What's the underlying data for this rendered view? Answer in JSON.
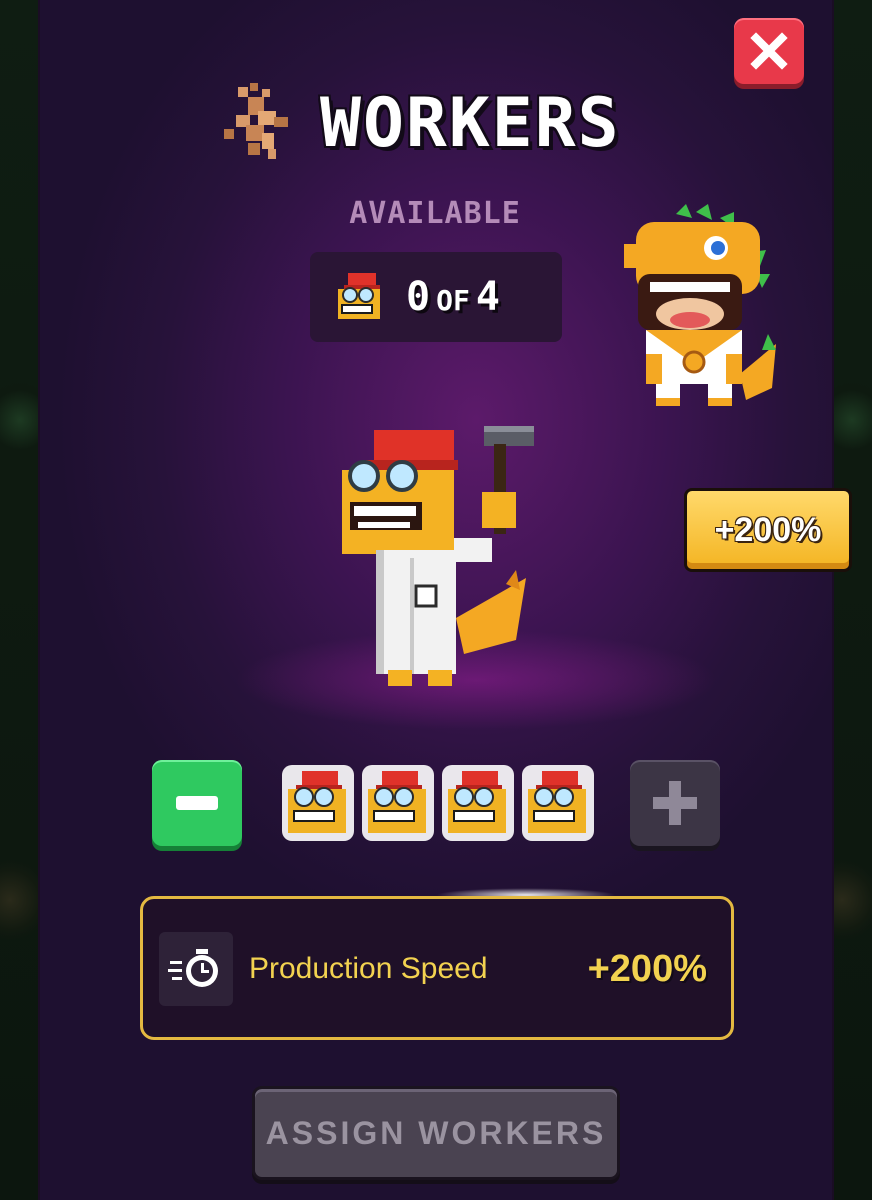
{
  "screen": {
    "title": "WORKERS",
    "close_icon": "close-x-icon"
  },
  "available": {
    "label": "AVAILABLE",
    "current": "0",
    "of_label": "OF",
    "total": "4"
  },
  "bonus_badge": {
    "text": "+200%"
  },
  "stepper": {
    "minus_icon": "minus-icon",
    "plus_icon": "plus-icon",
    "slots": [
      {
        "icon": "worker-head-icon",
        "filled": true
      },
      {
        "icon": "worker-head-icon",
        "filled": true
      },
      {
        "icon": "worker-head-icon",
        "filled": true
      },
      {
        "icon": "worker-head-icon",
        "filled": true
      }
    ]
  },
  "stat": {
    "icon": "fast-clock-icon",
    "label": "Production Speed",
    "value": "+200%"
  },
  "actions": {
    "assign_label": "ASSIGN WORKERS"
  },
  "colors": {
    "accent_gold": "#f2d250",
    "close_red": "#e8394a",
    "minus_green": "#2fc960",
    "panel_purple": "#3b1450",
    "disabled_gray": "#4a4351"
  }
}
